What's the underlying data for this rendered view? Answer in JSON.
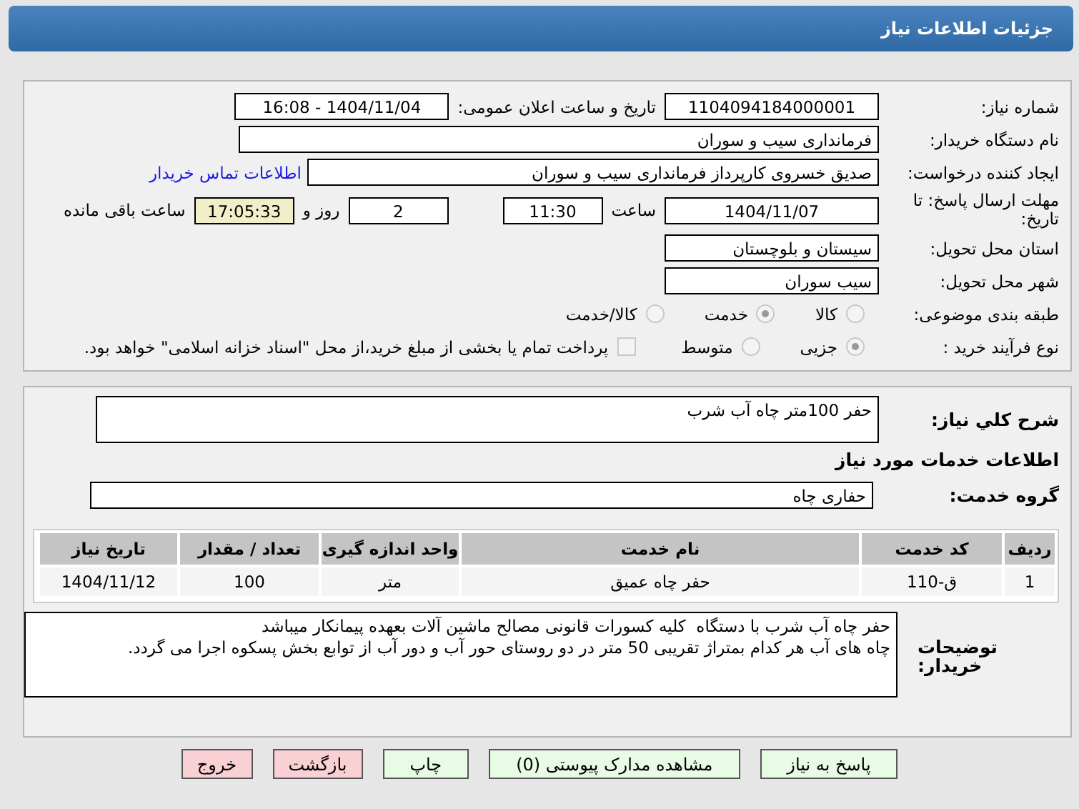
{
  "header": {
    "title": "جزئیات اطلاعات نیاز"
  },
  "need_number": {
    "label": "شماره نیاز:",
    "value": "1104094184000001"
  },
  "announce": {
    "label": "تاریخ و ساعت اعلان عمومی:",
    "value": "1404/11/04 - 16:08"
  },
  "buyer_org": {
    "label": "نام دستگاه خریدار:",
    "value": "فرمانداری سیب و سوران"
  },
  "requester": {
    "label": "ایجاد کننده درخواست:",
    "value": "صدیق خسروی کارپرداز فرمانداری سیب و سوران",
    "link": "اطلاعات تماس خریدار"
  },
  "deadline": {
    "label": "مهلت ارسال پاسخ: تا تاریخ:",
    "date": "1404/11/07",
    "time_label": "ساعت",
    "time": "11:30",
    "days": "2",
    "days_label": "روز و",
    "remaining": "17:05:33",
    "remaining_label": "ساعت باقی مانده"
  },
  "province": {
    "label": "استان محل تحویل:",
    "value": "سیستان و بلوچستان"
  },
  "city": {
    "label": "شهر محل تحویل:",
    "value": "سیب سوران"
  },
  "category": {
    "label": "طبقه بندی موضوعی:",
    "options": [
      {
        "label": "کالا",
        "selected": false
      },
      {
        "label": "خدمت",
        "selected": true
      },
      {
        "label": "کالا/خدمت",
        "selected": false
      }
    ]
  },
  "process": {
    "label": "نوع فرآیند خرید :",
    "options": [
      {
        "label": "جزیی",
        "selected": true
      },
      {
        "label": "متوسط",
        "selected": false
      }
    ],
    "payment": {
      "checked": false,
      "text": "پرداخت تمام یا بخشی از مبلغ خرید،از محل \"اسناد خزانه اسلامی\" خواهد بود."
    }
  },
  "description": {
    "label": "شرح کلي نياز:",
    "value": "حفر 100متر چاه آب شرب"
  },
  "services_heading": "اطلاعات خدمات مورد نیاز",
  "service_group": {
    "label": "گروه خدمت:",
    "value": "حفاری چاه"
  },
  "table": {
    "columns": [
      "ردیف",
      "کد خدمت",
      "نام خدمت",
      "واحد اندازه گیری",
      "تعداد / مقدار",
      "تاریخ نیاز"
    ],
    "rows": [
      [
        "1",
        "ق-110",
        "حفر چاه عمیق",
        "متر",
        "100",
        "1404/11/12"
      ]
    ]
  },
  "buyer_notes": {
    "label": "توضیحات خریدار:",
    "value": "حفر چاه آب شرب با دستگاه  کلیه کسورات قانونی مصالح ماشین آلات بعهده پیمانکار میباشد\nچاه های آب هر کدام بمتراژ تقریبی 50 متر در دو روستای حور آب و دور آب از توابع بخش پسکوه اجرا می گردد."
  },
  "buttons": [
    {
      "label": "پاسخ به نیاز",
      "kind": "normal"
    },
    {
      "label": "مشاهده مدارک پیوستی (0)",
      "kind": "normal"
    },
    {
      "label": "چاپ",
      "kind": "normal"
    },
    {
      "label": "بازگشت",
      "kind": "danger"
    },
    {
      "label": "خروج",
      "kind": "danger"
    }
  ]
}
